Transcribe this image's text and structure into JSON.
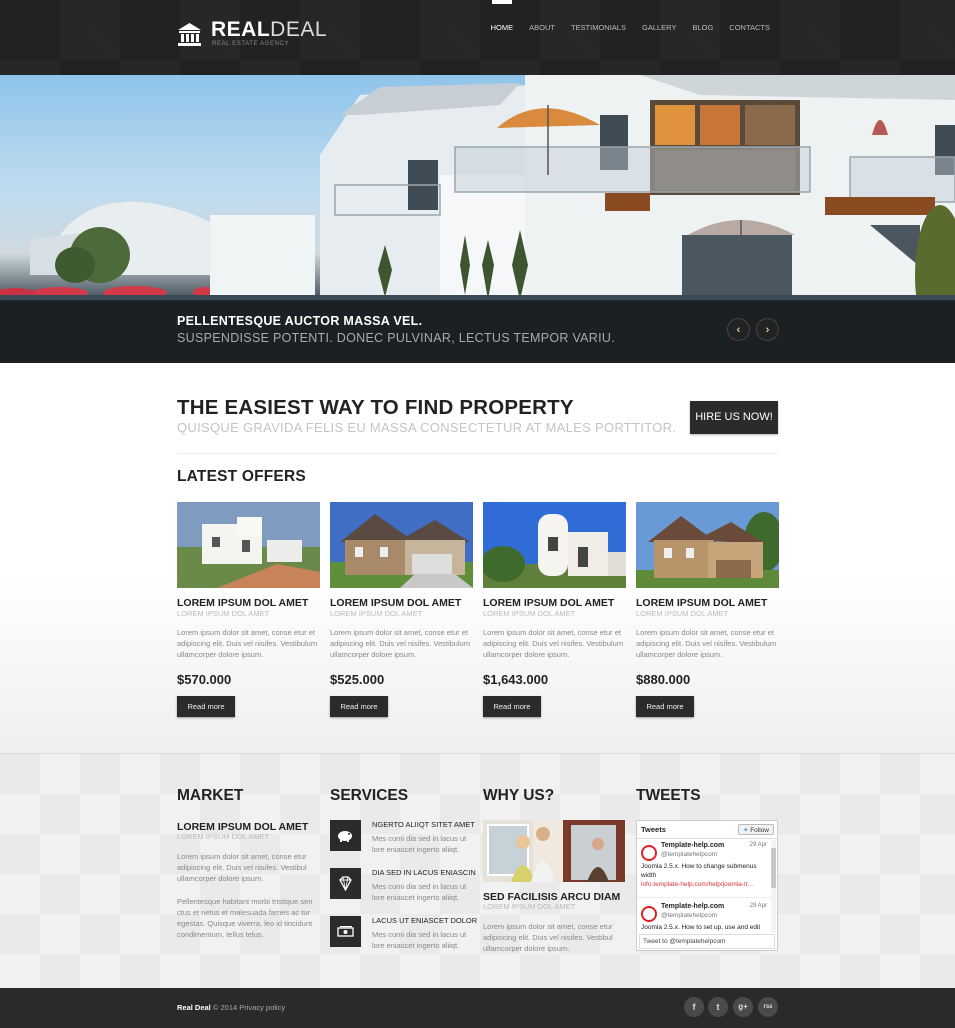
{
  "header": {
    "logo_bold": "REAL",
    "logo_light": "DEAL",
    "logo_tagline": "REAL ESTATE AGENCY",
    "nav": [
      "HOME",
      "ABOUT",
      "TESTIMONIALS",
      "GALLERY",
      "BLOG",
      "CONTACTS"
    ],
    "active_nav": "HOME"
  },
  "hero": {
    "caption_title": "PELLENTESQUE AUCTOR MASSA VEL.",
    "caption_sub": "SUSPENDISSE POTENTI. DONEC PULVINAR, LECTUS TEMPOR VARIU.",
    "prev_icon": "‹",
    "next_icon": "›"
  },
  "intro": {
    "title": "THE EASIEST WAY TO FIND PROPERTY",
    "subtitle": "QUISQUE GRAVIDA FELIS EU MASSA CONSECTETUR AT MALES PORTTITOR.",
    "button": "HIRE US NOW!"
  },
  "offers": {
    "heading": "LATEST OFFERS",
    "items": [
      {
        "title": "LOREM IPSUM DOL AMET",
        "subtitle": "LOREM IPSUM DOL AMET",
        "text": "Lorem ipsum dolor sit amet, conse etur et adipiscing elit. Duis vel nisifes. Vestibulum ullamcorper dolore ipsum.",
        "price": "$570.000",
        "button": "Read more"
      },
      {
        "title": "LOREM IPSUM DOL AMET",
        "subtitle": "LOREM IPSUM DOL AMET",
        "text": "Lorem ipsum dolor sit amet, conse etur et adipiscing elit. Duis vel nisifes. Vestibulum ullamcorper dolore ipsum.",
        "price": "$525.000",
        "button": "Read more"
      },
      {
        "title": "LOREM IPSUM DOL AMET",
        "subtitle": "LOREM IPSUM DOL AMET",
        "text": "Lorem ipsum dolor sit amet, conse etur et adipiscing elit. Duis vel nisifes. Vestibulum ullamcorper dolore ipsum.",
        "price": "$1,643.000",
        "button": "Read more"
      },
      {
        "title": "LOREM IPSUM DOL AMET",
        "subtitle": "LOREM IPSUM DOL AMET",
        "text": "Lorem ipsum dolor sit amet, conse etur et adipiscing elit. Duis vel nisifes. Vestibulum ullamcorper dolore ipsum.",
        "price": "$880.000",
        "button": "Read more"
      }
    ]
  },
  "market": {
    "heading": "MARKET",
    "title": "LOREM IPSUM DOL AMET",
    "subtitle": "LOREM IPSUM DOL AMET",
    "para1": "Lorem ipsum dolor sit amet, conse etur adipiscing elit. Duis vel nisifes. Vestibul ullamcorper dolore ipsum.",
    "para2": "Pellentesque habitant morbi tristique sen ctus et netus et malesuada fames ac tur egestas. Quisque viverra, leo id tincidunt condimentum, tellus telus."
  },
  "services": {
    "heading": "SERVICES",
    "items": [
      {
        "icon": "piggy-bank-icon",
        "title": "NGERTO ALIIQT SITET AMET",
        "text": "Mes cumi dia sed in lacus ut lore eniascet ingerto aliiqt."
      },
      {
        "icon": "diamond-icon",
        "title": "DIA SED IN LACUS ENIASCIN",
        "text": "Mes cumi dia sed in lacus ut lore eniascet ingerto aliiqt."
      },
      {
        "icon": "money-icon",
        "title": "LACUS UT ENIASCET DOLOR",
        "text": "Mes cumi dia sed in lacus ut lore eniascet ingerto aliiqt."
      }
    ]
  },
  "why": {
    "heading": "WHY US?",
    "title": "SED FACILISIS ARCU DIAM",
    "subtitle": "LOREM IPSUM DOL AMET",
    "text": "Lorem ipsum dolor sit amet, conse etur adipiscing elit. Duis vel nisifes. Vestibul ullamcorper dolore ipsum."
  },
  "tweets": {
    "heading": "TWEETS",
    "widget_title": "Tweets",
    "follow": "Follow",
    "items": [
      {
        "name": "Template-help.com",
        "handle": "@templatehelpcom",
        "date": "29 Apr",
        "text": "Joomla 2.5.x. How to change submenus width",
        "link": "info.template-help.com/help/joomla-tr..."
      },
      {
        "name": "Template-help.com",
        "handle": "@templatehelpcom",
        "date": "29 Apr",
        "text": "Joomla 2.5.x. How to set up, use and edit",
        "link": ""
      }
    ],
    "input_placeholder": "Tweet to @templatehelpcom"
  },
  "footer": {
    "brand": "Real Deal",
    "copyright": " © 2014 Privacy policy",
    "social": [
      {
        "icon": "facebook-icon",
        "glyph": "f"
      },
      {
        "icon": "twitter-icon",
        "glyph": "t"
      },
      {
        "icon": "google-plus-icon",
        "glyph": "g+"
      },
      {
        "icon": "rss-icon",
        "glyph": "rss"
      }
    ]
  },
  "colors": {
    "dark": "#2b2b2b",
    "accent_red": "#d33333"
  }
}
